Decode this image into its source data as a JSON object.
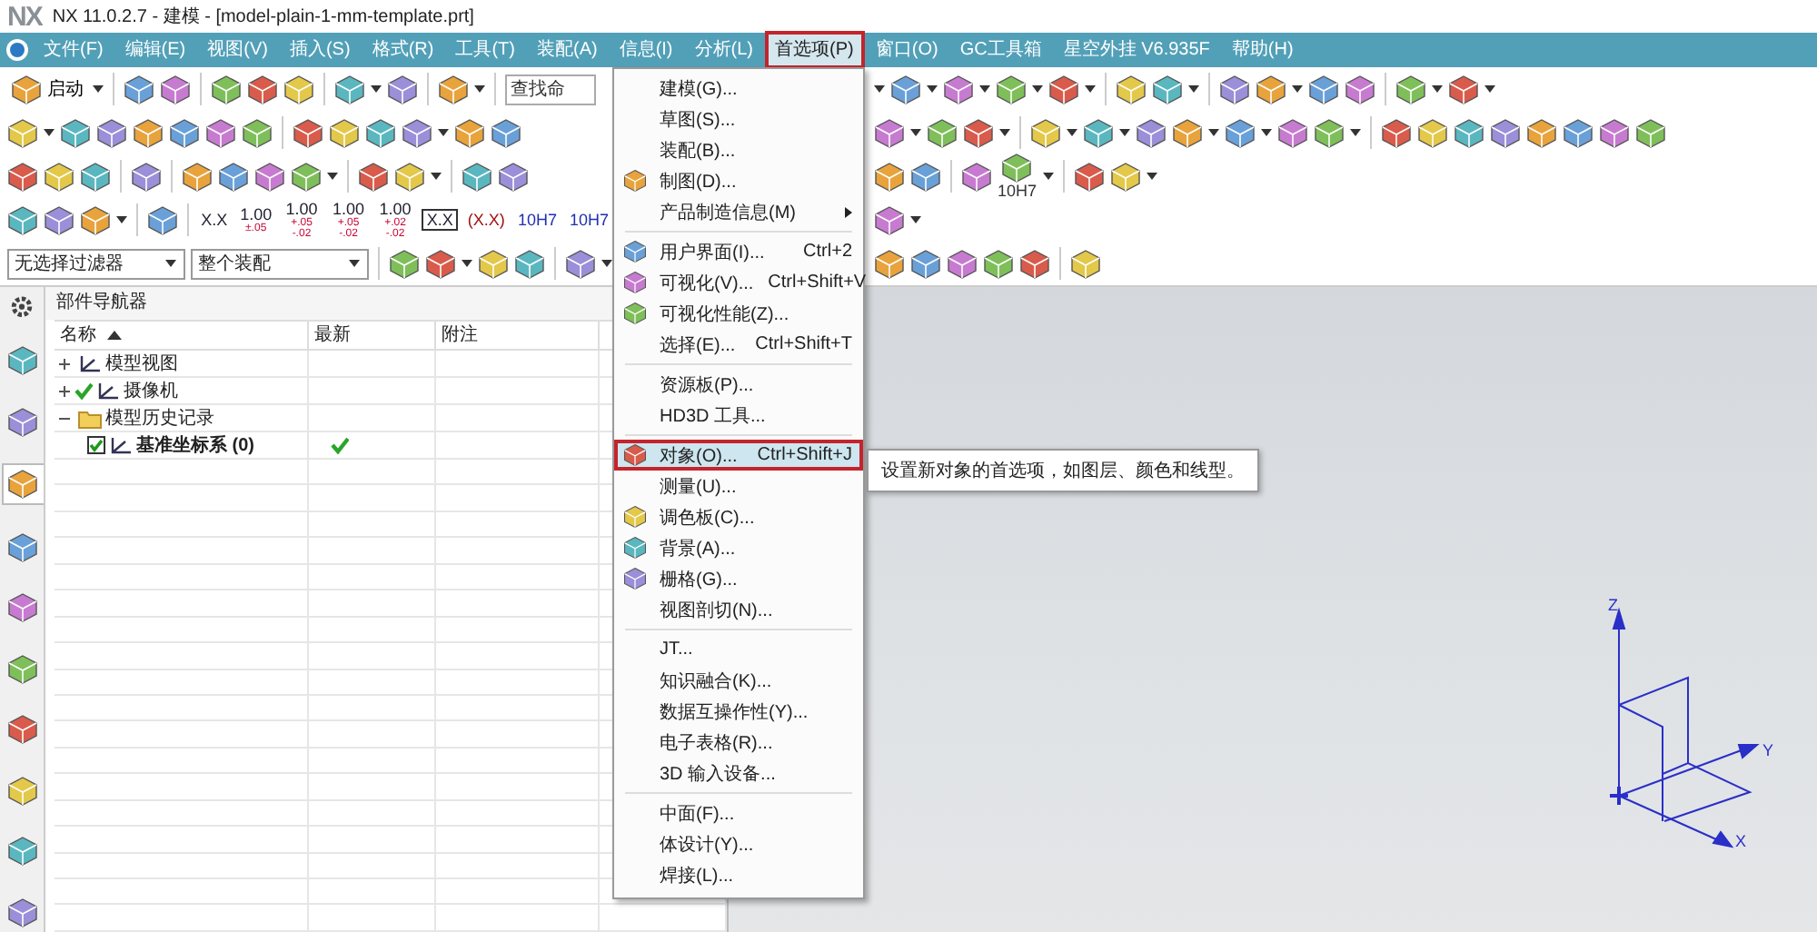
{
  "window": {
    "logo": "NX",
    "title": "NX 11.0.2.7 - 建模 - [model-plain-1-mm-template.prt]"
  },
  "menu_bar": [
    {
      "label": "文件(F)",
      "selected": false
    },
    {
      "label": "编辑(E)",
      "selected": false
    },
    {
      "label": "视图(V)",
      "selected": false
    },
    {
      "label": "插入(S)",
      "selected": false
    },
    {
      "label": "格式(R)",
      "selected": false
    },
    {
      "label": "工具(T)",
      "selected": false
    },
    {
      "label": "装配(A)",
      "selected": false
    },
    {
      "label": "信息(I)",
      "selected": false
    },
    {
      "label": "分析(L)",
      "selected": false
    },
    {
      "label": "首选项(P)",
      "selected": true
    },
    {
      "label": "窗口(O)",
      "selected": false
    },
    {
      "label": "GC工具箱",
      "selected": false
    },
    {
      "label": "星空外挂 V6.935F",
      "selected": false
    },
    {
      "label": "帮助(H)",
      "selected": false
    }
  ],
  "toolbars": {
    "start_button": "启动",
    "search": {
      "placeholder": "查找命"
    },
    "dimension_buttons": [
      {
        "kind": "plain",
        "main": "X.X"
      },
      {
        "kind": "stacked",
        "main": "1.00",
        "sub": "±.05"
      },
      {
        "kind": "stacked",
        "main": "1.00",
        "sub": "+.05 -.02"
      },
      {
        "kind": "stacked",
        "main": "1.00",
        "sub": "+.05 -.02"
      },
      {
        "kind": "stacked",
        "main": "1.00",
        "sub": "+.02 -.02"
      },
      {
        "kind": "boxed",
        "main": "X.X"
      },
      {
        "kind": "paren",
        "main": "(X.X)"
      },
      {
        "kind": "plain",
        "main": "10H7"
      },
      {
        "kind": "plain",
        "main": "10H7"
      }
    ],
    "tolerance_label": "10H7",
    "filters": [
      {
        "value": "无选择过滤器"
      },
      {
        "value": "整个装配"
      }
    ]
  },
  "sidebar_tabs": [
    {
      "selected": false
    },
    {
      "selected": false
    },
    {
      "selected": true
    },
    {
      "selected": false
    },
    {
      "selected": false
    },
    {
      "selected": false
    },
    {
      "selected": false
    },
    {
      "selected": false
    },
    {
      "selected": false
    },
    {
      "selected": false
    }
  ],
  "part_navigator": {
    "title": "部件导航器",
    "columns": [
      "名称",
      "最新",
      "附注"
    ],
    "items": [
      {
        "label": "模型视图",
        "expanded": false
      },
      {
        "label": "摄像机",
        "expanded": false,
        "visible": true
      },
      {
        "label": "模型历史记录",
        "expanded": true,
        "children": [
          {
            "label": "基准坐标系 (0)",
            "checked": true,
            "latest": true,
            "bold": true
          }
        ]
      }
    ]
  },
  "preferences_menu": {
    "groups": [
      [
        {
          "label": "建模(G)...",
          "icon": false,
          "selected": false
        },
        {
          "label": "草图(S)...",
          "icon": false,
          "selected": false
        },
        {
          "label": "装配(B)...",
          "icon": false,
          "selected": false
        },
        {
          "label": "制图(D)...",
          "icon": true,
          "selected": false
        },
        {
          "label": "产品制造信息(M)",
          "icon": false,
          "submenu": true,
          "selected": false
        }
      ],
      [
        {
          "label": "用户界面(I)...",
          "shortcut": "Ctrl+2",
          "icon": true,
          "selected": false
        },
        {
          "label": "可视化(V)...",
          "shortcut": "Ctrl+Shift+V",
          "icon": true,
          "selected": false
        },
        {
          "label": "可视化性能(Z)...",
          "icon": true,
          "selected": false
        },
        {
          "label": "选择(E)...",
          "shortcut": "Ctrl+Shift+T",
          "icon": false,
          "selected": false
        }
      ],
      [
        {
          "label": "资源板(P)...",
          "icon": false,
          "selected": false
        },
        {
          "label": "HD3D 工具...",
          "icon": false,
          "selected": false
        }
      ],
      [
        {
          "label": "对象(O)...",
          "shortcut": "Ctrl+Shift+J",
          "icon": true,
          "selected": true
        },
        {
          "label": "测量(U)...",
          "icon": false,
          "selected": false
        },
        {
          "label": "调色板(C)...",
          "icon": true,
          "selected": false
        },
        {
          "label": "背景(A)...",
          "icon": true,
          "selected": false
        },
        {
          "label": "栅格(G)...",
          "icon": true,
          "selected": false
        },
        {
          "label": "视图剖切(N)...",
          "icon": false,
          "selected": false
        }
      ],
      [
        {
          "label": "JT...",
          "icon": false,
          "selected": false
        },
        {
          "label": "知识融合(K)...",
          "icon": false,
          "selected": false
        },
        {
          "label": "数据互操作性(Y)...",
          "icon": false,
          "selected": false
        },
        {
          "label": "电子表格(R)...",
          "icon": false,
          "selected": false
        },
        {
          "label": "3D 输入设备...",
          "icon": false,
          "selected": false
        }
      ],
      [
        {
          "label": "中面(F)...",
          "icon": false,
          "selected": false
        },
        {
          "label": "体设计(Y)...",
          "icon": false,
          "selected": false
        },
        {
          "label": "焊接(L)...",
          "icon": false,
          "selected": false
        }
      ]
    ]
  },
  "tooltip": "设置新对象的首选项，如图层、颜色和线型。",
  "triad": {
    "x": "X",
    "y": "Y",
    "z": "Z"
  }
}
